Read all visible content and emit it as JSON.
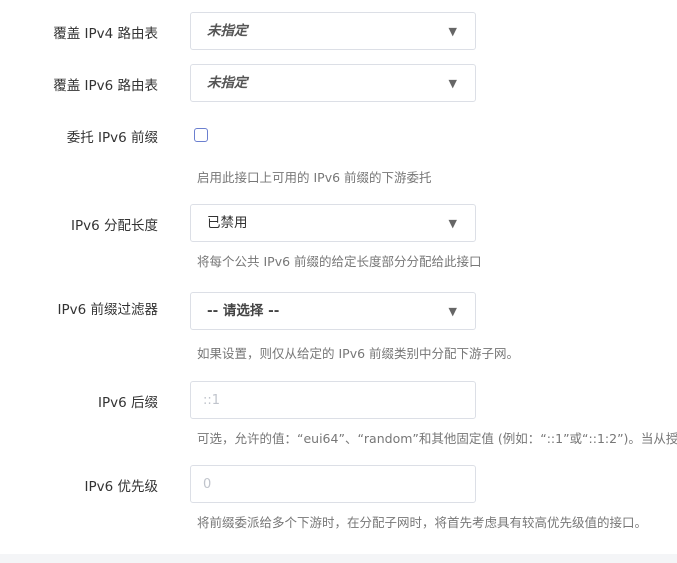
{
  "rows": {
    "ipv4_route": {
      "label": "覆盖 IPv4 路由表",
      "value": "未指定"
    },
    "ipv6_route": {
      "label": "覆盖 IPv6 路由表",
      "value": "未指定"
    },
    "delegate": {
      "label": "委托 IPv6 前缀",
      "hint": "启用此接口上可用的 IPv6 前缀的下游委托"
    },
    "assign_len": {
      "label": "IPv6 分配长度",
      "value": "已禁用",
      "hint": "将每个公共 IPv6 前缀的给定长度部分分配给此接口"
    },
    "prefix_filter": {
      "label": "IPv6 前缀过滤器",
      "value": "-- 请选择 --",
      "hint": "如果设置，则仅从给定的 IPv6 前缀类别中分配下游子网。"
    },
    "suffix": {
      "label": "IPv6 后缀",
      "placeholder": "::1",
      "hint": "可选，允许的值：“eui64”、“random”和其他固定值 (例如：“::1”或“::1:2”)。当从授权"
    },
    "priority": {
      "label": "IPv6 优先级",
      "placeholder": "0",
      "hint": "将前缀委派给多个下游时，在分配子网时，将首先考虑具有较高优先级值的接口。"
    }
  },
  "icons": {
    "dropdown": "▼"
  }
}
